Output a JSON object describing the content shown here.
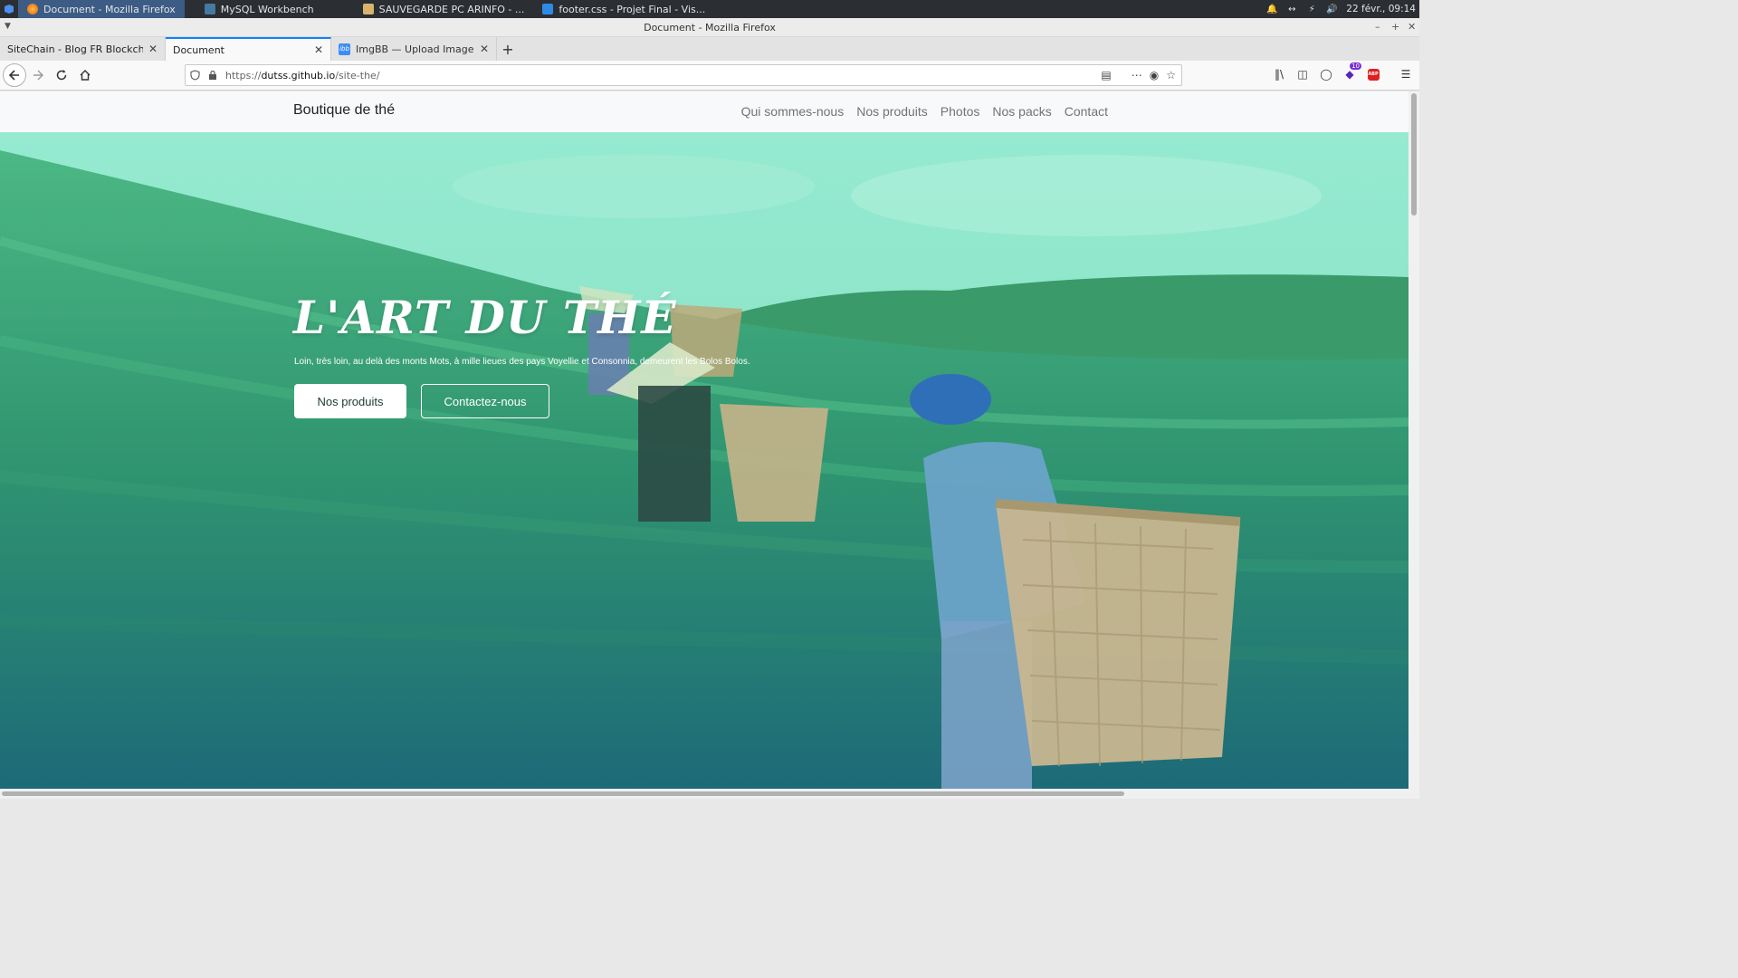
{
  "taskbar": {
    "tasks": [
      {
        "label": "Document - Mozilla Firefox",
        "icon": "firefox-icon",
        "color": "#e66000"
      },
      {
        "label": "MySQL Workbench",
        "icon": "mysql-workbench-icon",
        "color": "#4479a1"
      },
      {
        "label": "SAUVEGARDE PC ARINFO - ...",
        "icon": "folder-icon",
        "color": "#d9b36c"
      },
      {
        "label": "footer.css - Projet Final - Vis...",
        "icon": "vscode-icon",
        "color": "#2f8ae6"
      }
    ],
    "clock": "22 févr., 09:14"
  },
  "window": {
    "title": "Document - Mozilla Firefox"
  },
  "tabs": [
    {
      "label": "SiteChain - Blog FR Blockchain",
      "active": false
    },
    {
      "label": "Document",
      "active": true
    },
    {
      "label": "ImgBB — Upload Image — H",
      "active": false,
      "favicon": "ibb"
    }
  ],
  "url": {
    "scheme": "https://",
    "host": "dutss.github.io",
    "path": "/site-the/"
  },
  "toolbar": {
    "extension_badge": "10",
    "abp_label": "ABP"
  },
  "site": {
    "brand": "Boutique de thé",
    "nav": [
      "Qui sommes-nous",
      "Nos produits",
      "Photos",
      "Nos packs",
      "Contact"
    ],
    "hero": {
      "title": "L'ART DU THÉ",
      "subtitle": "Loin, très loin, au delà des monts Mots, à mille lieues des pays Voyellie et Consonnia, demeurent les Bolos Bolos.",
      "primary_button": "Nos produits",
      "secondary_button": "Contactez-nous"
    }
  },
  "colors": {
    "accent_tab": "#0a84ff",
    "hero_top": "#8fe6c0",
    "hero_bottom": "#1c6378"
  }
}
